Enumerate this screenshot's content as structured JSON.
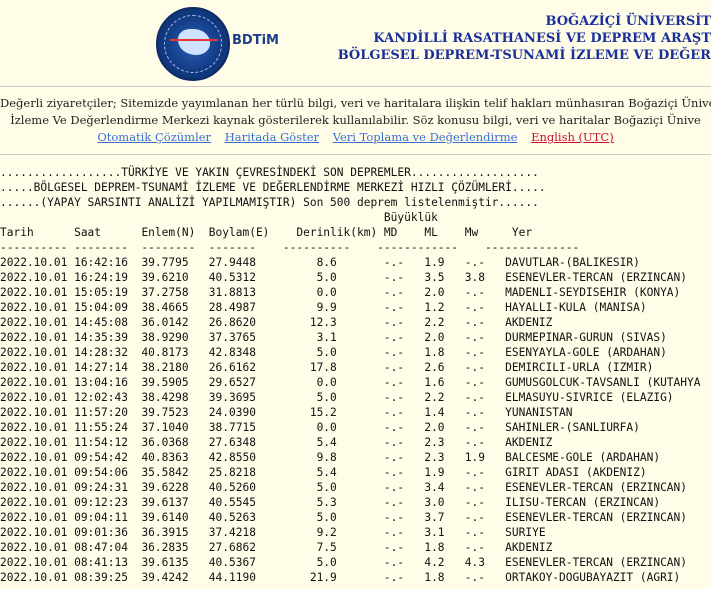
{
  "header": {
    "logo_text": "BDTiM",
    "institution_line1": "BOĞAZİÇİ ÜNİVERSİT",
    "institution_line2": "KANDİLLİ RASATHANESİ VE DEPREM ARAŞT",
    "institution_line3": "BÖLGESEL DEPREM-TSUNAMİ İZLEME VE DEĞER"
  },
  "notice": {
    "line1": "Değerli ziyaretçiler; Sitemizde yayımlanan her türlü bilgi, veri ve haritalara ilişkin telif hakları münhasıran Boğaziçi Üniversitesi Rektör",
    "line2": "İzleme Ve Değerlendirme Merkezi kaynak gösterilerek kullanılabilir. Söz konusu bilgi, veri ve haritalar Boğaziçi Ünive"
  },
  "links": {
    "auto": "Otomatik Çözümler",
    "map": "Haritada Göster",
    "data": "Veri Toplama ve Değerlendirme",
    "english": "English (UTC)"
  },
  "listing": {
    "title1": "..................TÜRKİYE VE YAKIN ÇEVRESİNDEKİ SON DEPREMLER...................",
    "title2": ".....BÖLGESEL DEPREM-TSUNAMİ İZLEME VE DEĞERLENDİRME MERKEZİ HIZLI ÇÖZÜMLERİ.....",
    "title3": "......(YAPAY SARSINTI ANALİZİ YAPILMAMIŞTIR) Son 500 deprem listelenmiştir......",
    "magnitude_header": "Büyüklük",
    "columns": [
      "Tarih",
      "Saat",
      "Enlem(N)",
      "Boylam(E)",
      "Derinlik(km)",
      "MD",
      "ML",
      "Mw",
      "Yer"
    ],
    "rows": [
      [
        "2022.10.01",
        "16:42:16",
        "39.7795",
        "27.9448",
        "8.6",
        "-.-",
        "1.9",
        "-.-",
        "DAVUTLAR-(BALIKESIR)"
      ],
      [
        "2022.10.01",
        "16:24:19",
        "39.6210",
        "40.5312",
        "5.0",
        "-.-",
        "3.5",
        "3.8",
        "ESENEVLER-TERCAN (ERZINCAN)"
      ],
      [
        "2022.10.01",
        "15:05:19",
        "37.2758",
        "31.8813",
        "0.0",
        "-.-",
        "2.0",
        "-.-",
        "MADENLI-SEYDISEHIR (KONYA)"
      ],
      [
        "2022.10.01",
        "15:04:09",
        "38.4665",
        "28.4987",
        "9.9",
        "-.-",
        "1.2",
        "-.-",
        "HAYALLI-KULA (MANISA)"
      ],
      [
        "2022.10.01",
        "14:45:08",
        "36.0142",
        "26.8620",
        "12.3",
        "-.-",
        "2.2",
        "-.-",
        "AKDENIZ"
      ],
      [
        "2022.10.01",
        "14:35:39",
        "38.9290",
        "37.3765",
        "3.1",
        "-.-",
        "2.0",
        "-.-",
        "DURMEPINAR-GURUN (SIVAS)"
      ],
      [
        "2022.10.01",
        "14:28:32",
        "40.8173",
        "42.8348",
        "5.0",
        "-.-",
        "1.8",
        "-.-",
        "ESENYAYLA-GOLE (ARDAHAN)"
      ],
      [
        "2022.10.01",
        "14:27:14",
        "38.2180",
        "26.6162",
        "17.8",
        "-.-",
        "2.6",
        "-.-",
        "DEMIRCILI-URLA (IZMIR)"
      ],
      [
        "2022.10.01",
        "13:04:16",
        "39.5905",
        "29.6527",
        "0.0",
        "-.-",
        "1.6",
        "-.-",
        "GUMUSGOLCUK-TAVSANLI (KUTAHYA"
      ],
      [
        "2022.10.01",
        "12:02:43",
        "38.4298",
        "39.3695",
        "5.0",
        "-.-",
        "2.2",
        "-.-",
        "ELMASUYU-SIVRICE (ELAZIG)"
      ],
      [
        "2022.10.01",
        "11:57:20",
        "39.7523",
        "24.0390",
        "15.2",
        "-.-",
        "1.4",
        "-.-",
        "YUNANISTAN"
      ],
      [
        "2022.10.01",
        "11:55:24",
        "37.1040",
        "38.7715",
        "0.0",
        "-.-",
        "2.0",
        "-.-",
        "SAHINLER-(SANLIURFA)"
      ],
      [
        "2022.10.01",
        "11:54:12",
        "36.0368",
        "27.6348",
        "5.4",
        "-.-",
        "2.3",
        "-.-",
        "AKDENIZ"
      ],
      [
        "2022.10.01",
        "09:54:42",
        "40.8363",
        "42.8550",
        "9.8",
        "-.-",
        "2.3",
        "1.9",
        "BALCESME-GOLE (ARDAHAN)"
      ],
      [
        "2022.10.01",
        "09:54:06",
        "35.5842",
        "25.8218",
        "5.4",
        "-.-",
        "1.9",
        "-.-",
        "GIRIT ADASI (AKDENIZ)"
      ],
      [
        "2022.10.01",
        "09:24:31",
        "39.6228",
        "40.5260",
        "5.0",
        "-.-",
        "3.4",
        "-.-",
        "ESENEVLER-TERCAN (ERZINCAN)"
      ],
      [
        "2022.10.01",
        "09:12:23",
        "39.6137",
        "40.5545",
        "5.3",
        "-.-",
        "3.0",
        "-.-",
        "ILISU-TERCAN (ERZINCAN)"
      ],
      [
        "2022.10.01",
        "09:04:11",
        "39.6140",
        "40.5263",
        "5.0",
        "-.-",
        "3.7",
        "-.-",
        "ESENEVLER-TERCAN (ERZINCAN)"
      ],
      [
        "2022.10.01",
        "09:01:36",
        "36.3915",
        "37.4218",
        "9.2",
        "-.-",
        "3.1",
        "-.-",
        "SURIYE"
      ],
      [
        "2022.10.01",
        "08:47:04",
        "36.2835",
        "27.6862",
        "7.5",
        "-.-",
        "1.8",
        "-.-",
        "AKDENIZ"
      ],
      [
        "2022.10.01",
        "08:41:13",
        "39.6135",
        "40.5367",
        "5.0",
        "-.-",
        "4.2",
        "4.3",
        "ESENEVLER-TERCAN (ERZINCAN)"
      ],
      [
        "2022.10.01",
        "08:39:25",
        "39.4242",
        "44.1190",
        "21.9",
        "-.-",
        "1.8",
        "-.-",
        "ORTAKOY-DOGUBAYAZIT (AGRI)"
      ]
    ]
  }
}
